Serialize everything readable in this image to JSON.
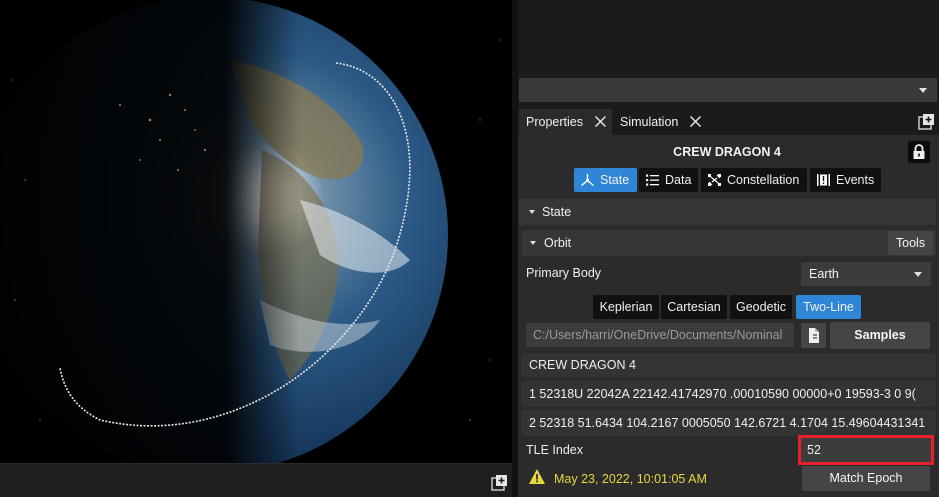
{
  "top_dropdown": {
    "value": ""
  },
  "tabs": [
    {
      "label": "Properties",
      "active": true
    },
    {
      "label": "Simulation",
      "active": false
    }
  ],
  "object_title": "CREW DRAGON 4",
  "view_tabs": [
    {
      "label": "State",
      "icon": "axes-icon",
      "active": true
    },
    {
      "label": "Data",
      "icon": "list-icon",
      "active": false
    },
    {
      "label": "Constellation",
      "icon": "satellites-icon",
      "active": false
    },
    {
      "label": "Events",
      "icon": "events-icon",
      "active": false
    }
  ],
  "sections": {
    "state": "State",
    "orbit": "Orbit",
    "tools_button": "Tools"
  },
  "primary_body": {
    "label": "Primary Body",
    "value": "Earth"
  },
  "element_types": [
    {
      "label": "Keplerian",
      "active": false
    },
    {
      "label": "Cartesian",
      "active": false
    },
    {
      "label": "Geodetic",
      "active": false
    },
    {
      "label": "Two-Line",
      "active": true
    }
  ],
  "file": {
    "path": "C:/Users/harri/OneDrive/Documents/Nominal",
    "samples_button": "Samples"
  },
  "tle": {
    "name": "CREW DRAGON 4",
    "line1": "1 52318U 22042A   22142.41742970  .00010590  00000+0  19593-3 0  9(",
    "line2": "2 52318  51.6434 104.2167 0005050 142.6721   4.1704 15.49604431341"
  },
  "tle_index": {
    "label": "TLE Index",
    "value": "52"
  },
  "epoch": {
    "text": "May 23, 2022, 10:01:05 AM",
    "button": "Match Epoch"
  },
  "colors": {
    "accent": "#2f86d6",
    "warning": "#e8d640",
    "highlight": "#e8202a"
  }
}
